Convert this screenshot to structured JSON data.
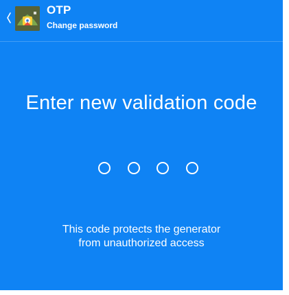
{
  "header": {
    "title": "OTP",
    "subtitle": "Change password",
    "back_icon": "chevron-left-icon",
    "app_icon": "otp-app-icon"
  },
  "main": {
    "heading": "Enter new validation code",
    "code_length": 4,
    "entered_digits": 0,
    "info_line1": "This code protects the generator",
    "info_line2": "from unauthorized access"
  },
  "colors": {
    "background": "#0f83f4",
    "text": "#ffffff"
  }
}
